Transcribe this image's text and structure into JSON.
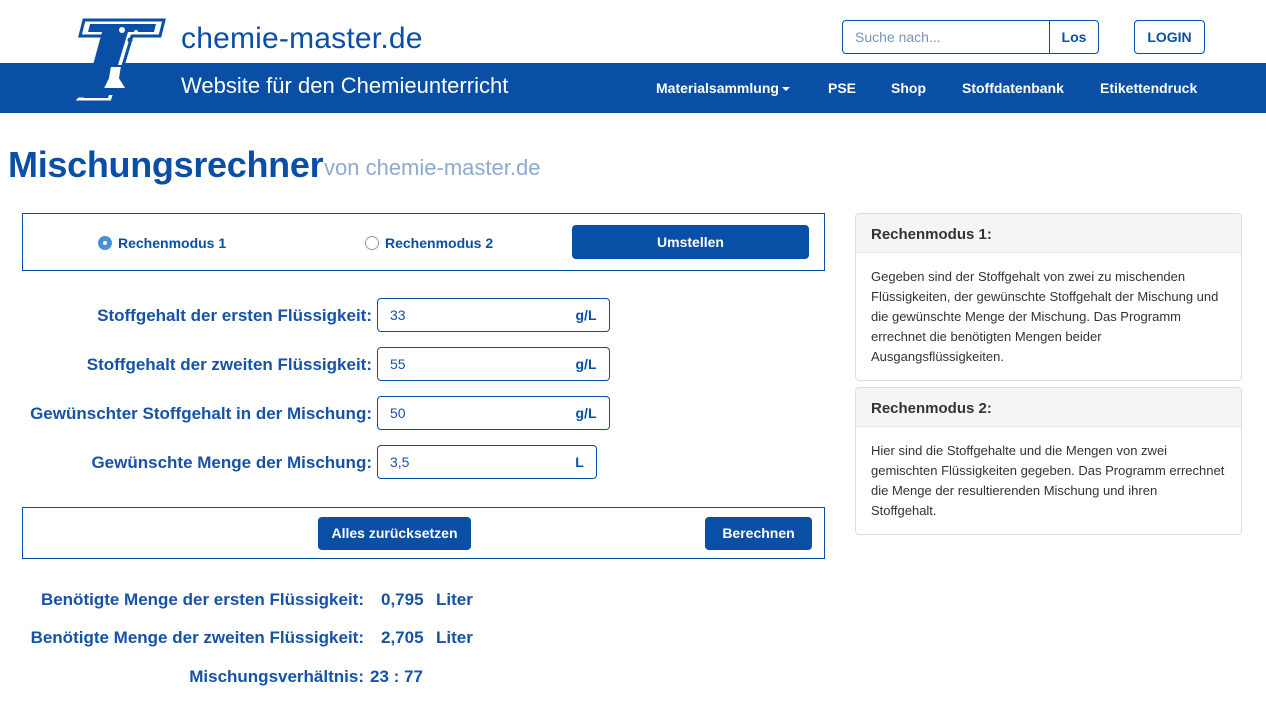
{
  "header": {
    "site_name": "chemie-master.de",
    "tagline": "Website für den Chemieunterricht",
    "search_placeholder": "Suche nach...",
    "search_button": "Los",
    "login_button": "LOGIN",
    "nav": [
      "Materialsammlung",
      "PSE",
      "Shop",
      "Stoffdatenbank",
      "Etikettendruck"
    ]
  },
  "title": {
    "main": "Mischungsrechner",
    "sub": "von chemie-master.de"
  },
  "mode": {
    "option1": "Rechenmodus 1",
    "option2": "Rechenmodus 2",
    "selected": "Rechenmodus 1",
    "switch_button": "Umstellen"
  },
  "form": {
    "fields": [
      {
        "label": "Stoffgehalt der ersten Flüssigkeit:",
        "value": "33",
        "unit": "g/L"
      },
      {
        "label": "Stoffgehalt der zweiten Flüssigkeit:",
        "value": "55",
        "unit": "g/L"
      },
      {
        "label": "Gewünschter Stoffgehalt in der Mischung:",
        "value": "50",
        "unit": "g/L"
      },
      {
        "label": "Gewünschte Menge der Mischung:",
        "value": "3,5",
        "unit": "L"
      }
    ]
  },
  "actions": {
    "reset": "Alles zurücksetzen",
    "calculate": "Berechnen"
  },
  "results": {
    "first_label": "Benötigte Menge der ersten Flüssigkeit:",
    "first_value": "0,795",
    "first_unit": "Liter",
    "second_label": "Benötigte Menge der zweiten Flüssigkeit:",
    "second_value": "2,705",
    "second_unit": "Liter",
    "ratio_label": "Mischungsverhältnis:",
    "ratio_value": "23 : 77"
  },
  "info": [
    {
      "title": "Rechenmodus 1:",
      "text": "Gegeben sind der Stoffgehalt von zwei zu mischenden Flüssigkeiten, der gewünschte Stoffgehalt der Mischung und die gewünschte Menge der Mischung. Das Programm errechnet die benötigten Mengen beider Ausgangsflüssigkeiten."
    },
    {
      "title": "Rechenmodus 2:",
      "text": "Hier sind die Stoffgehalte und die Mengen von zwei gemischten Flüssigkeiten gegeben. Das Programm errechnet die Menge der resultierenden Mischung und ihren Stoffgehalt."
    }
  ],
  "colors": {
    "brand_blue": "#0a4fa6",
    "subtitle_blue": "#8fa9cf"
  }
}
